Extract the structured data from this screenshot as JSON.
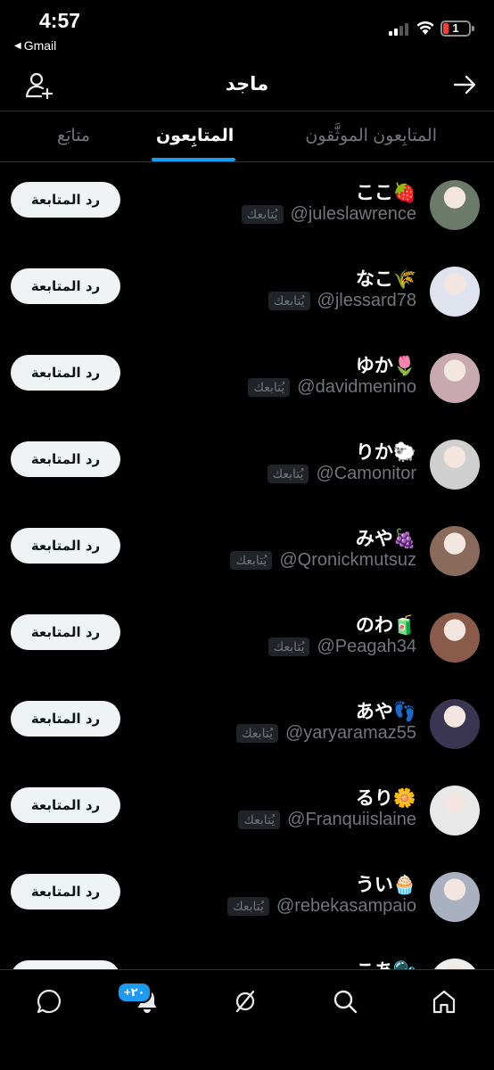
{
  "status_bar": {
    "time": "4:57",
    "back_app": "Gmail",
    "battery": "1"
  },
  "header": {
    "title": "ماجد",
    "add_icon": "add-person-icon",
    "forward_icon": "arrow-right-icon"
  },
  "tabs": [
    {
      "label": "المتابِعون الموثَّقون",
      "active": false
    },
    {
      "label": "المتابِعون",
      "active": true
    },
    {
      "label": "متابَع",
      "active": false
    }
  ],
  "follow_back_label": "رد المتابعة",
  "follows_you_label": "يُتابعك",
  "followers": [
    {
      "name": "ここ🍓",
      "handle": "@juleslawrence"
    },
    {
      "name": "なこ🌾",
      "handle": "@jlessard78"
    },
    {
      "name": "ゆか🌷",
      "handle": "@davidmenino"
    },
    {
      "name": "りか🐑",
      "handle": "@Camonitor"
    },
    {
      "name": "みや🍇",
      "handle": "@Qronickmutsuz"
    },
    {
      "name": "のわ🧃",
      "handle": "@Peagah34"
    },
    {
      "name": "あや👣",
      "handle": "@yaryaramaz55"
    },
    {
      "name": "るり🌼",
      "handle": "@Franquiislaine"
    },
    {
      "name": "うい🧁",
      "handle": "@rebekasampaio"
    },
    {
      "name": "こあ🫧",
      "handle": ""
    }
  ],
  "avatar_colors": [
    "#6c7a6a",
    "#dfe3ee",
    "#c9a9b0",
    "#cfcfcf",
    "#8a6a5a",
    "#8a5a4a",
    "#3a3550",
    "#e8e8e8",
    "#a9b0c0",
    "#eeeeee"
  ],
  "bottom_nav": {
    "icons": [
      "chat-icon",
      "bell-icon",
      "slash-circle-icon",
      "search-icon",
      "home-icon"
    ],
    "notif_badge": "+٢٠"
  },
  "colors": {
    "accent": "#1d9bf0",
    "muted": "#71767b",
    "button_bg": "#eff3f4"
  }
}
